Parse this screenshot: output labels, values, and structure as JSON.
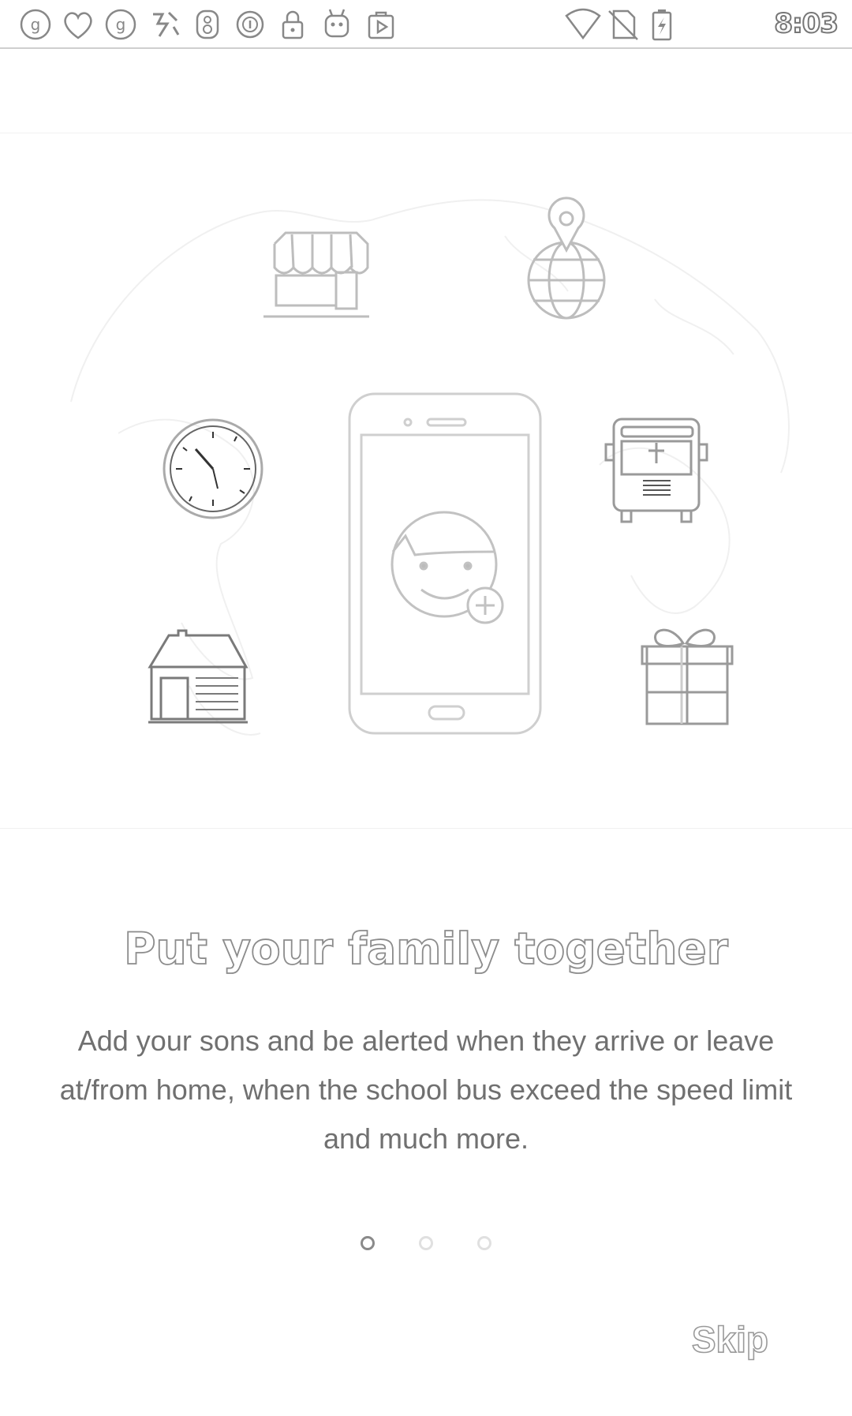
{
  "status_bar": {
    "time": "8:03",
    "left_icons": [
      "notification-icon",
      "heart-icon",
      "notification-icon",
      "app-icon",
      "app-icon",
      "app-icon",
      "lock-icon",
      "android-icon",
      "play-store-icon"
    ],
    "right_icons": [
      "wifi-icon",
      "no-sim-icon",
      "battery-charging-icon"
    ]
  },
  "onboarding": {
    "title": "Put your family together",
    "description": "Add your sons and be alerted when they arrive or leave at/from home, when the school bus exceed the speed limit and much more.",
    "page_indicator": {
      "count": 3,
      "active": 1
    },
    "skip_label": "Skip"
  },
  "colors": {
    "line_art": "#bdbdbd",
    "indicator_active": "#8a8a8a",
    "indicator_inactive": "#e0e0e0"
  }
}
